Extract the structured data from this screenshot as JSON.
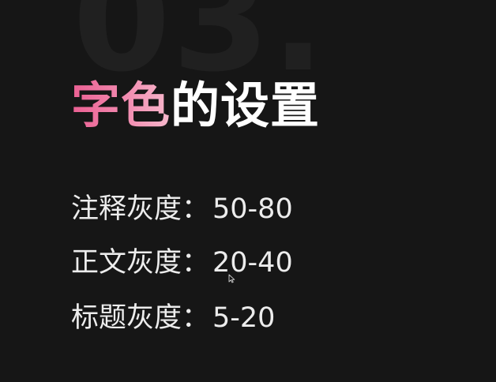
{
  "slide": {
    "bg_number": "03.",
    "title_accent": "字色",
    "title_rest": "的设置",
    "items": [
      {
        "label": "注释灰度：",
        "value": "50-80"
      },
      {
        "label": "正文灰度：",
        "value": "20-40"
      },
      {
        "label": "标题灰度：",
        "value": "5-20"
      }
    ]
  },
  "colors": {
    "background": "#161616",
    "accent_start": "#ea5f92",
    "accent_end": "#f7b8cc",
    "text": "#ececec"
  },
  "icons": {
    "cursor": "mouse-pointer-icon"
  }
}
